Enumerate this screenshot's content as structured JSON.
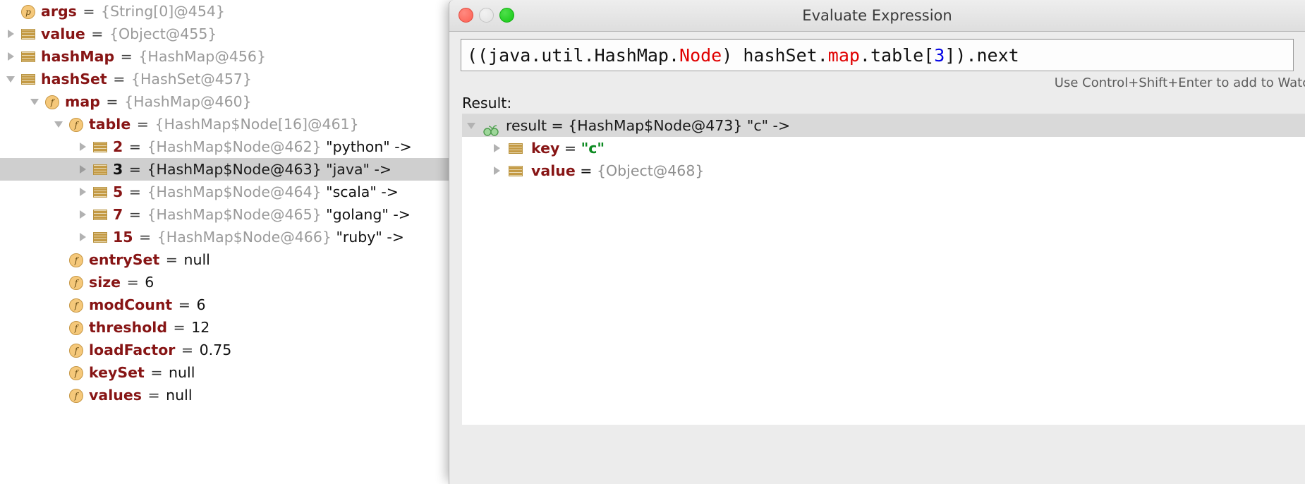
{
  "variables_panel": {
    "name": "Variables",
    "rows": [
      {
        "indent": 0,
        "twisty": "none",
        "icon": "param-badge",
        "icon_text": "p",
        "name": "args",
        "eq": " = ",
        "ref": "{String[0]@454}",
        "str": "",
        "selected": false
      },
      {
        "indent": 0,
        "twisty": "right",
        "icon": "object-stripes",
        "icon_text": "",
        "name": "value",
        "eq": " = ",
        "ref": "{Object@455}",
        "str": "",
        "selected": false
      },
      {
        "indent": 0,
        "twisty": "right",
        "icon": "object-stripes",
        "icon_text": "",
        "name": "hashMap",
        "eq": " = ",
        "ref": "{HashMap@456}",
        "str": "",
        "selected": false
      },
      {
        "indent": 0,
        "twisty": "down",
        "icon": "object-stripes",
        "icon_text": "",
        "name": "hashSet",
        "eq": " = ",
        "ref": "{HashSet@457}",
        "str": "",
        "selected": false
      },
      {
        "indent": 1,
        "twisty": "down",
        "icon": "field-badge",
        "icon_text": "f",
        "name": "map",
        "eq": " = ",
        "ref": "{HashMap@460}",
        "str": "",
        "selected": false
      },
      {
        "indent": 2,
        "twisty": "down",
        "icon": "field-badge",
        "icon_text": "f",
        "name": "table",
        "eq": " = ",
        "ref": "{HashMap$Node[16]@461}",
        "str": "",
        "selected": false
      },
      {
        "indent": 3,
        "twisty": "right",
        "icon": "object-stripes",
        "icon_text": "",
        "name": "2",
        "eq": " = ",
        "ref": "{HashMap$Node@462}",
        "str": "\"python\" ->",
        "selected": false
      },
      {
        "indent": 3,
        "twisty": "right",
        "icon": "object-stripes",
        "icon_text": "",
        "name": "3",
        "eq": " = ",
        "ref": "{HashMap$Node@463}",
        "str": "\"java\" ->",
        "selected": true
      },
      {
        "indent": 3,
        "twisty": "right",
        "icon": "object-stripes",
        "icon_text": "",
        "name": "5",
        "eq": " = ",
        "ref": "{HashMap$Node@464}",
        "str": "\"scala\" ->",
        "selected": false
      },
      {
        "indent": 3,
        "twisty": "right",
        "icon": "object-stripes",
        "icon_text": "",
        "name": "7",
        "eq": " = ",
        "ref": "{HashMap$Node@465}",
        "str": "\"golang\" ->",
        "selected": false
      },
      {
        "indent": 3,
        "twisty": "right",
        "icon": "object-stripes",
        "icon_text": "",
        "name": "15",
        "eq": " = ",
        "ref": "{HashMap$Node@466}",
        "str": "\"ruby\" ->",
        "selected": false
      },
      {
        "indent": 2,
        "twisty": "none",
        "icon": "field-badge",
        "icon_text": "f",
        "name": "entrySet",
        "eq": " = ",
        "ref": "",
        "str": "null",
        "selected": false
      },
      {
        "indent": 2,
        "twisty": "none",
        "icon": "field-badge",
        "icon_text": "f",
        "name": "size",
        "eq": " = ",
        "ref": "",
        "str": "6",
        "selected": false
      },
      {
        "indent": 2,
        "twisty": "none",
        "icon": "field-badge",
        "icon_text": "f",
        "name": "modCount",
        "eq": " = ",
        "ref": "",
        "str": "6",
        "selected": false
      },
      {
        "indent": 2,
        "twisty": "none",
        "icon": "field-badge",
        "icon_text": "f",
        "name": "threshold",
        "eq": " = ",
        "ref": "",
        "str": "12",
        "selected": false
      },
      {
        "indent": 2,
        "twisty": "none",
        "icon": "field-badge",
        "icon_text": "f",
        "name": "loadFactor",
        "eq": " = ",
        "ref": "",
        "str": "0.75",
        "selected": false
      },
      {
        "indent": 2,
        "twisty": "none",
        "icon": "field-badge",
        "icon_text": "f",
        "name": "keySet",
        "eq": " = ",
        "ref": "",
        "str": "null",
        "selected": false
      },
      {
        "indent": 2,
        "twisty": "none",
        "icon": "field-badge",
        "icon_text": "f",
        "name": "values",
        "eq": " = ",
        "ref": "",
        "str": "null",
        "selected": false
      }
    ]
  },
  "dialog": {
    "title": "Evaluate Expression",
    "window_buttons": {
      "close": "close-button",
      "minimize": "minimize-button",
      "zoom": "zoom-button"
    },
    "expression": {
      "full_text": "((java.util.HashMap.Node) hashSet.map.table[3]).next",
      "tokens": [
        {
          "t": "((java.util.HashMap.",
          "k": "plain"
        },
        {
          "t": "Node",
          "k": "type"
        },
        {
          "t": ") hashSet.",
          "k": "plain"
        },
        {
          "t": "map",
          "k": "field"
        },
        {
          "t": ".table[",
          "k": "plain"
        },
        {
          "t": "3",
          "k": "num"
        },
        {
          "t": "]).next",
          "k": "plain"
        }
      ]
    },
    "hint": "Use Control+Shift+Enter to add to Watches",
    "result_label": "Result:",
    "result_rows": [
      {
        "indent": 0,
        "twisty": "down",
        "icon": "glasses-icon",
        "name": "result",
        "eq": " = ",
        "ref": "{HashMap$Node@473}",
        "str": "\"c\" ->",
        "str_kind": "plain",
        "selected": true
      },
      {
        "indent": 1,
        "twisty": "right",
        "icon": "object-stripes",
        "name": "key",
        "eq": " = ",
        "ref": "",
        "str": "\"c\"",
        "str_kind": "string",
        "selected": false
      },
      {
        "indent": 1,
        "twisty": "right",
        "icon": "object-stripes",
        "name": "value",
        "eq": " = ",
        "ref": "{Object@468}",
        "str": "",
        "str_kind": "plain",
        "selected": false
      }
    ]
  },
  "colors": {
    "field_name": "#871515",
    "reference": "#9a9a9a",
    "string_value": "#0b8a20",
    "selection": "#cfcfcf",
    "syntax_type": "#e00000",
    "syntax_number": "#0000e6"
  }
}
